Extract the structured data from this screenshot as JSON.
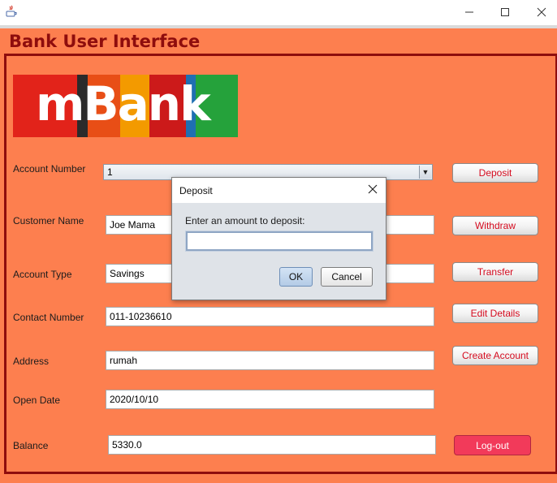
{
  "window": {
    "app_icon": "java-icon",
    "controls": [
      "minimize-icon",
      "maximize-icon",
      "close-icon"
    ]
  },
  "app": {
    "title": "Bank User Interface",
    "logo_text": "mBank",
    "colors": {
      "panel_bg": "#fd7f4f",
      "title": "#8e0d0d",
      "button_text": "#d50b1f",
      "logout_bg": "#f23a5a"
    }
  },
  "form": {
    "account_number": {
      "label": "Account Number",
      "value": "1"
    },
    "customer_name": {
      "label": "Customer Name",
      "value": "Joe Mama"
    },
    "account_type": {
      "label": "Account Type",
      "value": "Savings"
    },
    "contact_number": {
      "label": "Contact Number",
      "value": "011-10236610"
    },
    "address": {
      "label": "Address",
      "value": "rumah"
    },
    "open_date": {
      "label": "Open Date",
      "value": "2020/10/10"
    },
    "balance": {
      "label": "Balance",
      "value": "5330.0"
    }
  },
  "buttons": {
    "deposit": "Deposit",
    "withdraw": "Withdraw",
    "transfer": "Transfer",
    "edit_details": "Edit Details",
    "create_account": "Create Account",
    "logout": "Log-out"
  },
  "dialog": {
    "title": "Deposit",
    "message": "Enter an amount to deposit:",
    "input_value": "",
    "ok": "OK",
    "cancel": "Cancel"
  }
}
